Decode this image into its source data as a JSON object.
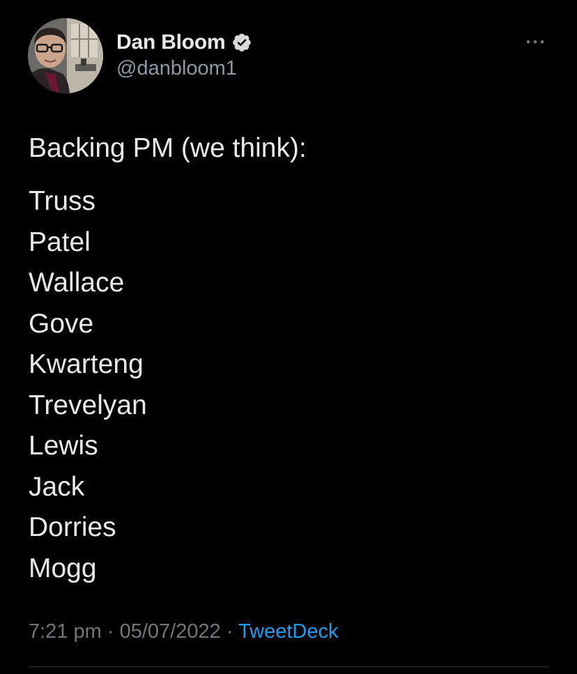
{
  "tweet": {
    "author": {
      "display_name": "Dan Bloom",
      "handle": "@danbloom1",
      "verified_icon": "verified-badge-icon",
      "avatar_icon": "profile-photo"
    },
    "more_icon": "more-options-icon",
    "text_lead": "Backing PM (we think):",
    "names": [
      "Truss",
      "Patel",
      "Wallace",
      "Gove",
      "Kwarteng",
      "Trevelyan",
      "Lewis",
      "Jack",
      "Dorries",
      "Mogg"
    ],
    "time": "7:21 pm",
    "separator": "·",
    "date": "05/07/2022",
    "source": "TweetDeck"
  },
  "colors": {
    "background": "#000000",
    "primary_text": "#e7e9ea",
    "secondary_text": "#71767b",
    "handle_text": "#8b98a5",
    "link": "#1d9bf0",
    "divider": "#2f3336"
  }
}
